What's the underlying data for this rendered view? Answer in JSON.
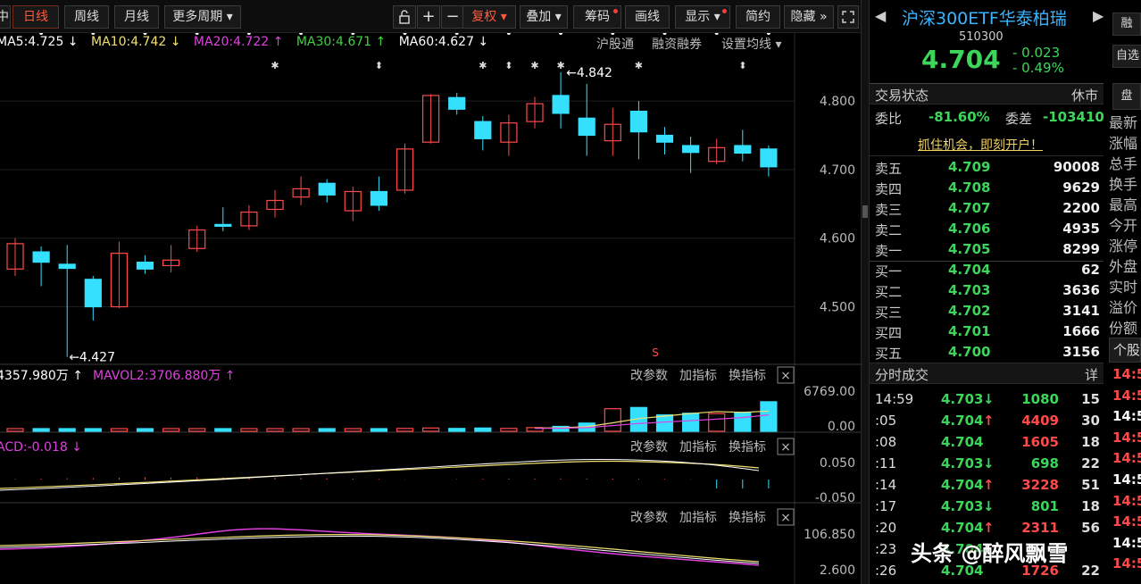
{
  "toolbar": {
    "left_stub": "中",
    "day": "日线",
    "week": "周线",
    "month": "月线",
    "more": "更多周期",
    "fuquan": "复权",
    "overlay": "叠加",
    "chips": "筹码",
    "draw": "画线",
    "show": "显示",
    "simple": "简约",
    "hide": "隐藏",
    "plus": "+",
    "minus": "−"
  },
  "ma": {
    "ma5": "MA5:4.725 ↓",
    "ma10": "MA10:4.742 ↓",
    "ma20": "MA20:4.722 ↑",
    "ma30": "MA30:4.671 ↑",
    "ma60": "MA60:4.627 ↓",
    "hgt": "沪股通",
    "margin": "融资融券",
    "setma": "设置均线"
  },
  "vol": {
    "mavol1": "4357.980万 ↑",
    "mavol2": "MAVOL2:3706.880万 ↑",
    "top": "6769.00",
    "bottom": "0.00"
  },
  "macd": {
    "label": "ACD:-0.018 ↓",
    "top": "0.050",
    "bottom": "-0.050"
  },
  "ind3": {
    "top": "106.850",
    "bottom": "2.600"
  },
  "panel_btns": {
    "params": "改参数",
    "add": "加指标",
    "swap": "换指标",
    "close": "×"
  },
  "chart_data": {
    "type": "candlestick",
    "y_ticks": [
      4.8,
      4.7,
      4.6,
      4.5
    ],
    "ylim": [
      4.42,
      4.86
    ],
    "high_label": "4.842",
    "low_label": "4.427",
    "candles": [
      {
        "o": 4.555,
        "c": 4.592,
        "h": 4.6,
        "l": 4.545
      },
      {
        "o": 4.58,
        "c": 4.565,
        "h": 4.588,
        "l": 4.53
      },
      {
        "o": 4.562,
        "c": 4.556,
        "h": 4.59,
        "l": 4.427
      },
      {
        "o": 4.54,
        "c": 4.5,
        "h": 4.545,
        "l": 4.48
      },
      {
        "o": 4.5,
        "c": 4.578,
        "h": 4.595,
        "l": 4.498
      },
      {
        "o": 4.565,
        "c": 4.555,
        "h": 4.575,
        "l": 4.548
      },
      {
        "o": 4.56,
        "c": 4.568,
        "h": 4.59,
        "l": 4.55
      },
      {
        "o": 4.585,
        "c": 4.612,
        "h": 4.618,
        "l": 4.58
      },
      {
        "o": 4.62,
        "c": 4.62,
        "h": 4.645,
        "l": 4.61
      },
      {
        "o": 4.618,
        "c": 4.638,
        "h": 4.648,
        "l": 4.612
      },
      {
        "o": 4.642,
        "c": 4.655,
        "h": 4.67,
        "l": 4.63
      },
      {
        "o": 4.66,
        "c": 4.672,
        "h": 4.69,
        "l": 4.648
      },
      {
        "o": 4.68,
        "c": 4.663,
        "h": 4.686,
        "l": 4.652
      },
      {
        "o": 4.64,
        "c": 4.668,
        "h": 4.675,
        "l": 4.625
      },
      {
        "o": 4.668,
        "c": 4.648,
        "h": 4.69,
        "l": 4.64
      },
      {
        "o": 4.67,
        "c": 4.73,
        "h": 4.738,
        "l": 4.665
      },
      {
        "o": 4.74,
        "c": 4.808,
        "h": 4.81,
        "l": 4.738
      },
      {
        "o": 4.805,
        "c": 4.788,
        "h": 4.812,
        "l": 4.78
      },
      {
        "o": 4.77,
        "c": 4.745,
        "h": 4.778,
        "l": 4.728
      },
      {
        "o": 4.74,
        "c": 4.768,
        "h": 4.78,
        "l": 4.72
      },
      {
        "o": 4.77,
        "c": 4.796,
        "h": 4.806,
        "l": 4.76
      },
      {
        "o": 4.808,
        "c": 4.782,
        "h": 4.842,
        "l": 4.76
      },
      {
        "o": 4.775,
        "c": 4.75,
        "h": 4.825,
        "l": 4.72
      },
      {
        "o": 4.742,
        "c": 4.766,
        "h": 4.79,
        "l": 4.72
      },
      {
        "o": 4.785,
        "c": 4.755,
        "h": 4.8,
        "l": 4.715
      },
      {
        "o": 4.75,
        "c": 4.74,
        "h": 4.762,
        "l": 4.722
      },
      {
        "o": 4.735,
        "c": 4.725,
        "h": 4.748,
        "l": 4.695
      },
      {
        "o": 4.712,
        "c": 4.732,
        "h": 4.745,
        "l": 4.708
      },
      {
        "o": 4.735,
        "c": 4.724,
        "h": 4.758,
        "l": 4.712
      },
      {
        "o": 4.73,
        "c": 4.704,
        "h": 4.735,
        "l": 4.69
      }
    ],
    "volumes": [
      0.03,
      0.03,
      0.03,
      0.03,
      0.04,
      0.04,
      0.04,
      0.04,
      0.04,
      0.05,
      0.05,
      0.06,
      0.06,
      0.05,
      0.06,
      0.07,
      0.08,
      0.07,
      0.08,
      0.07,
      0.09,
      0.12,
      0.2,
      0.55,
      0.58,
      0.4,
      0.44,
      0.43,
      0.46,
      0.72
    ]
  },
  "quote": {
    "name": "沪深300ETF华泰柏瑞",
    "code": "510300",
    "price": "4.704",
    "chg": "- 0.023",
    "pct": "- 0.49%",
    "status_label": "交易状态",
    "status_val": "休市",
    "weibi_label": "委比",
    "weibi_val": "-81.60%",
    "weicha_label": "委差",
    "weicha_val": "-103410",
    "promo": "抓住机会，即刻开户！",
    "btn_rong": "融",
    "btn_zi": "自选",
    "btn_pan": "盘",
    "trades_title": "分时成交",
    "trades_detail": "详",
    "ge": "个股"
  },
  "orderbook": [
    {
      "l": "卖五",
      "p": "4.709",
      "v": "90008"
    },
    {
      "l": "卖四",
      "p": "4.708",
      "v": "9629"
    },
    {
      "l": "卖三",
      "p": "4.707",
      "v": "2200"
    },
    {
      "l": "卖二",
      "p": "4.706",
      "v": "4935"
    },
    {
      "l": "卖一",
      "p": "4.705",
      "v": "8299"
    },
    {
      "l": "买一",
      "p": "4.704",
      "v": "62"
    },
    {
      "l": "买二",
      "p": "4.703",
      "v": "3636"
    },
    {
      "l": "买三",
      "p": "4.702",
      "v": "3141"
    },
    {
      "l": "买四",
      "p": "4.701",
      "v": "1666"
    },
    {
      "l": "买五",
      "p": "4.700",
      "v": "3156"
    }
  ],
  "edge_labels": [
    "最新",
    "涨幅",
    "总手",
    "换手",
    "最高",
    "今开",
    "涨停",
    "外盘",
    "实时",
    "溢价",
    "份额"
  ],
  "edge_times": [
    "14:5",
    "14:5",
    "14:5",
    "14:5",
    "14:5",
    "14:5",
    "14:5",
    "14:5",
    "14:5",
    "14:5"
  ],
  "trades": [
    {
      "t": "14:59",
      "p": "4.703",
      "a": "↓",
      "v": "1080",
      "n": "15",
      "c": "#3cd65a"
    },
    {
      "t": ":05",
      "p": "4.704",
      "a": "↑",
      "v": "4409",
      "n": "30",
      "c": "#ff4a4a"
    },
    {
      "t": ":08",
      "p": "4.704",
      "a": "",
      "v": "1605",
      "n": "18",
      "c": "#ff4a4a"
    },
    {
      "t": ":11",
      "p": "4.703",
      "a": "↓",
      "v": "698",
      "n": "22",
      "c": "#3cd65a"
    },
    {
      "t": ":14",
      "p": "4.704",
      "a": "↑",
      "v": "3228",
      "n": "51",
      "c": "#ff4a4a"
    },
    {
      "t": ":17",
      "p": "4.703",
      "a": "↓",
      "v": "801",
      "n": "18",
      "c": "#3cd65a"
    },
    {
      "t": ":20",
      "p": "4.704",
      "a": "↑",
      "v": "2311",
      "n": "56",
      "c": "#ff4a4a"
    },
    {
      "t": ":23",
      "p": "4.704",
      "a": "↑",
      "v": "",
      "n": "",
      "c": "#ff4a4a"
    },
    {
      "t": ":26",
      "p": "4.704",
      "a": "",
      "v": "1726",
      "n": "22",
      "c": "#ff4a4a"
    }
  ],
  "watermark": "头条 @醉风飘雪",
  "colors": {
    "up": "#ff4a4a",
    "down": "#35e0ff",
    "ma5": "#ffffff",
    "ma10": "#f0e070",
    "ma20": "#e040e0",
    "ma30": "#40d040",
    "ma60": "#ffffff"
  }
}
